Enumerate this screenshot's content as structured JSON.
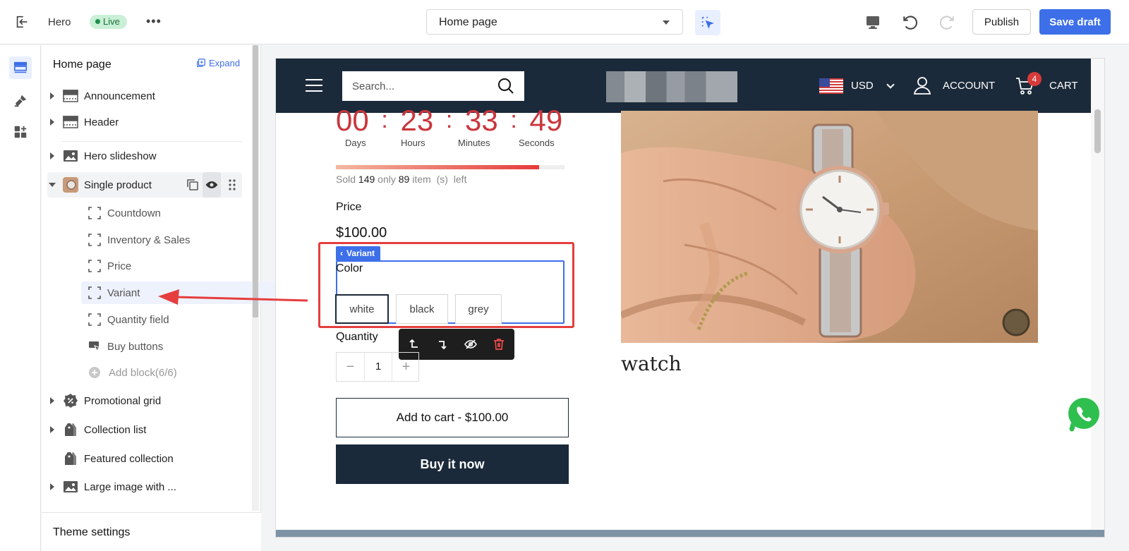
{
  "topbar": {
    "theme_name": "Hero",
    "live_label": "Live",
    "page_select": "Home page",
    "publish_label": "Publish",
    "save_label": "Save draft"
  },
  "sidebar": {
    "title": "Home page",
    "expand_label": "Expand",
    "sections": [
      {
        "label": "Announcement",
        "icon": "layout-icon"
      },
      {
        "label": "Header",
        "icon": "layout-icon"
      },
      {
        "label": "Hero slideshow",
        "icon": "image-icon"
      },
      {
        "label": "Single product",
        "icon": "product-thumb"
      },
      {
        "label": "Promotional grid",
        "icon": "percent-badge-icon"
      },
      {
        "label": "Collection list",
        "icon": "tag-icon"
      },
      {
        "label": "Featured collection",
        "icon": "tag-icon"
      },
      {
        "label": "Large image with ...",
        "icon": "image-icon"
      }
    ],
    "blocks": [
      {
        "label": "Countdown",
        "icon": "block-icon"
      },
      {
        "label": "Inventory & Sales",
        "icon": "block-icon"
      },
      {
        "label": "Price",
        "icon": "block-icon"
      },
      {
        "label": "Variant",
        "icon": "block-icon"
      },
      {
        "label": "Quantity field",
        "icon": "block-icon"
      },
      {
        "label": "Buy buttons",
        "icon": "buy-button-icon"
      },
      {
        "label": "Add block(6/6)",
        "icon": "plus-circle-icon"
      }
    ],
    "footer_label": "Theme settings"
  },
  "store": {
    "search_placeholder": "Search...",
    "currency": "USD",
    "account_label": "ACCOUNT",
    "cart_label": "CART",
    "cart_count": "4"
  },
  "product": {
    "countdown": {
      "days": "00",
      "hours": "23",
      "minutes": "33",
      "seconds": "49",
      "sep": ":"
    },
    "countdown_labels": {
      "days": "Days",
      "hours": "Hours",
      "minutes": "Minutes",
      "seconds": "Seconds"
    },
    "sold_progress": 0.89,
    "sold_text": {
      "sold": "Sold",
      "sold_count": "149",
      "only": "only",
      "left_count": "89",
      "item": "item",
      "s": "(s)",
      "left": "left"
    },
    "price_label": "Price",
    "price": "$100.00",
    "variant_tag": "Variant",
    "color_label": "Color",
    "swatches": [
      "white",
      "black",
      "grey"
    ],
    "selected_swatch": "white",
    "quantity_label": "Quantity",
    "quantity": "1",
    "add_to_cart": "Add to cart - $100.00",
    "buy_now": "Buy it now",
    "title": "watch"
  },
  "colors": {
    "accent": "#3d6fe8",
    "store_dark": "#1b2a3a",
    "countdown_red": "#c9363c",
    "annotation_red": "#e53e3e",
    "live_green": "#1f8f4e"
  }
}
